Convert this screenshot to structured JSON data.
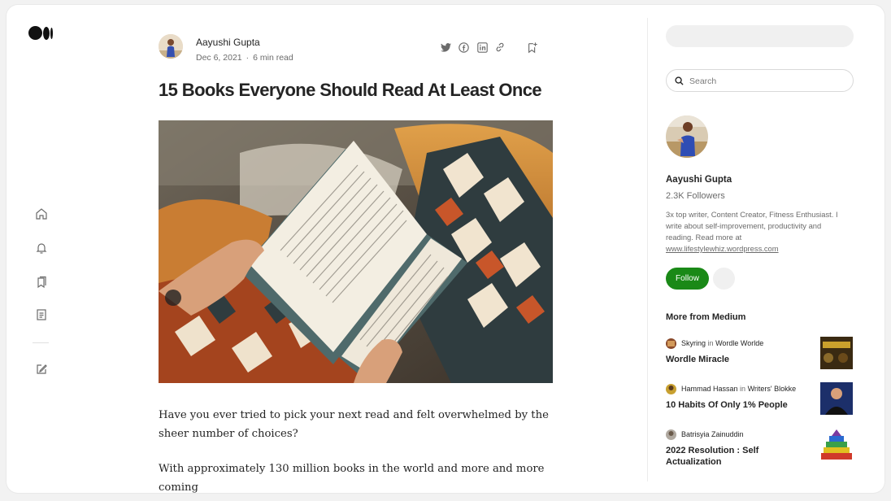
{
  "brand": {
    "logo": "medium-logo"
  },
  "rail": {
    "items": [
      {
        "name": "home",
        "icon": "home-icon"
      },
      {
        "name": "notifications",
        "icon": "bell-icon"
      },
      {
        "name": "lists",
        "icon": "bookmarks-icon"
      },
      {
        "name": "stories",
        "icon": "document-icon"
      },
      {
        "name": "write",
        "icon": "write-icon"
      }
    ]
  },
  "article": {
    "author": "Aayushi Gupta",
    "date": "Dec 6, 2021",
    "read_time": "6 min read",
    "dot": "·",
    "title": "15 Books Everyone Should Read At Least Once",
    "hero_image": "person reading an open book",
    "paragraphs": [
      "Have you ever tried to pick your next read and felt overwhelmed by the sheer number of choices?",
      "With approximately 130 million books in the world and more and more coming"
    ],
    "share_icons": [
      "twitter-icon",
      "facebook-icon",
      "linkedin-icon",
      "link-icon",
      "bookmark-add-icon"
    ]
  },
  "sidebar": {
    "search_placeholder": "Search",
    "profile": {
      "name": "Aayushi Gupta",
      "followers": "2.3K Followers",
      "bio": "3x top writer, Content Creator, Fitness Enthusiast. I write about self-improvement, productivity and reading. Read more at",
      "link": "www.lifestylewhiz.wordpress.com",
      "follow_label": "Follow"
    },
    "more_title": "More from Medium",
    "stories": [
      {
        "author": "Skyring",
        "in": "in",
        "publication": "Wordle Worlde",
        "title": "Wordle Miracle"
      },
      {
        "author": "Hammad Hassan",
        "in": "in",
        "publication": "Writers' Blokke",
        "title": "10 Habits Of Only 1% People"
      },
      {
        "author": "Batrisyia Zainuddin",
        "in": "",
        "publication": "",
        "title": "2022 Resolution : Self Actualization"
      }
    ]
  },
  "colors": {
    "follow": "#1a8917",
    "text": "#242424",
    "muted": "#6b6b6b"
  }
}
